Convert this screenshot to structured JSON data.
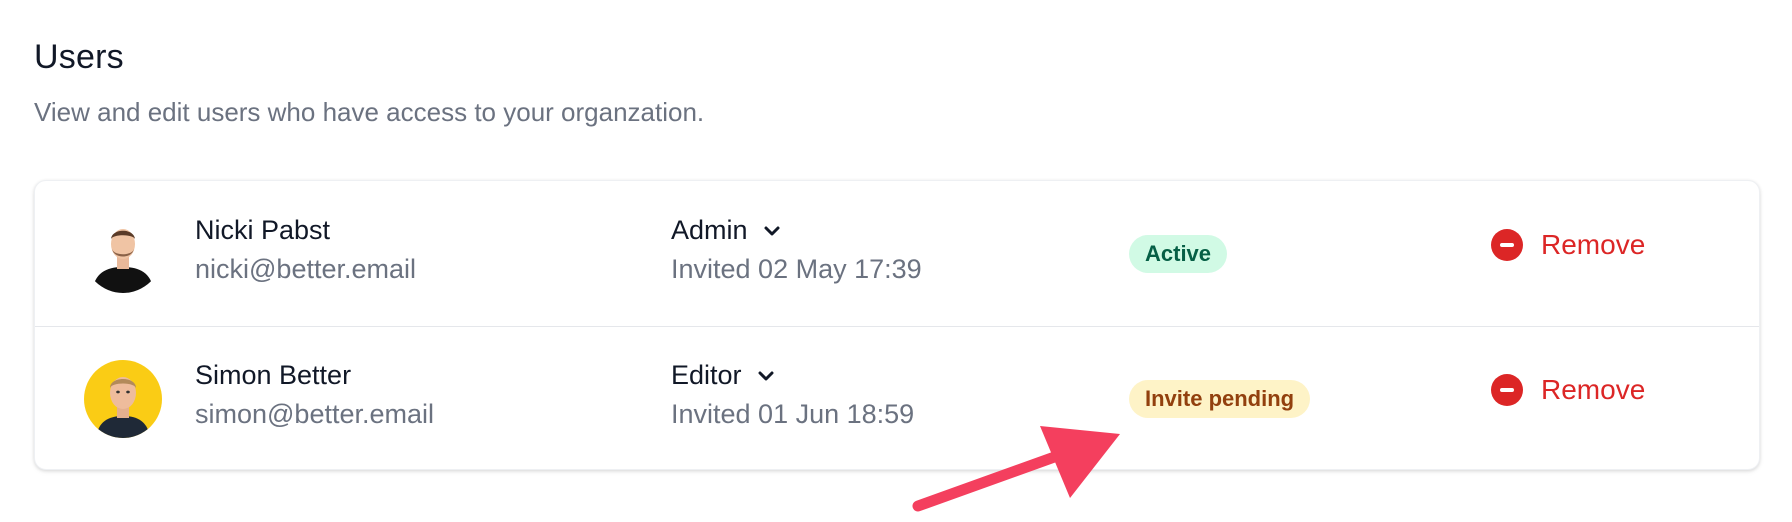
{
  "header": {
    "title": "Users",
    "subtitle": "View and edit users who have access to your organzation."
  },
  "users": [
    {
      "name": "Nicki Pabst",
      "email": "nicki@better.email",
      "role": "Admin",
      "invited": "Invited 02 May 17:39",
      "status": "Active",
      "remove_label": "Remove"
    },
    {
      "name": "Simon Better",
      "email": "simon@better.email",
      "role": "Editor",
      "invited": "Invited 01 Jun 18:59",
      "status": "Invite pending",
      "remove_label": "Remove"
    }
  ],
  "colors": {
    "active_bg": "#d1fae5",
    "active_text": "#065f46",
    "pending_bg": "#fef3c7",
    "pending_text": "#92400e",
    "remove": "#dc2626",
    "annotation_arrow": "#f43f5e"
  }
}
